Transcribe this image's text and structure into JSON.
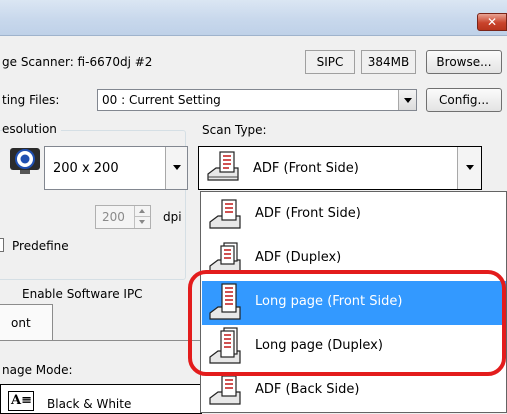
{
  "window": {
    "close_glyph": "✕"
  },
  "scanner": {
    "label": "ge Scanner: fi-6670dj #2",
    "sipc": "SIPC",
    "memory": "384MB",
    "browse": "Browse..."
  },
  "setting": {
    "label": "ting Files:",
    "value": "00 : Current Setting",
    "config": "Config..."
  },
  "resolution": {
    "group_label": "esolution",
    "value": "200 x 200",
    "custom_value": "200",
    "unit": "dpi",
    "predefine": "Predefine"
  },
  "scan_type": {
    "label": "Scan Type:",
    "selected": "ADF (Front Side)",
    "options": [
      "ADF (Front Side)",
      "ADF (Duplex)",
      "Long page (Front Side)",
      "Long page (Duplex)",
      "ADF (Back Side)"
    ],
    "highlighted": "Long page (Front Side)"
  },
  "software_ipc": {
    "label": "Enable Software IPC"
  },
  "tab": {
    "label": "ont"
  },
  "image_mode": {
    "label": "nage Mode:",
    "value": "Black & White"
  },
  "more_button": "...",
  "annotation": {
    "color": "#e31c1c"
  },
  "icons": [
    "close-icon",
    "scanner-icon",
    "monitor-icon",
    "document-text-icon",
    "dropdown-arrow-icon",
    "spin-up-icon",
    "spin-down-icon"
  ]
}
